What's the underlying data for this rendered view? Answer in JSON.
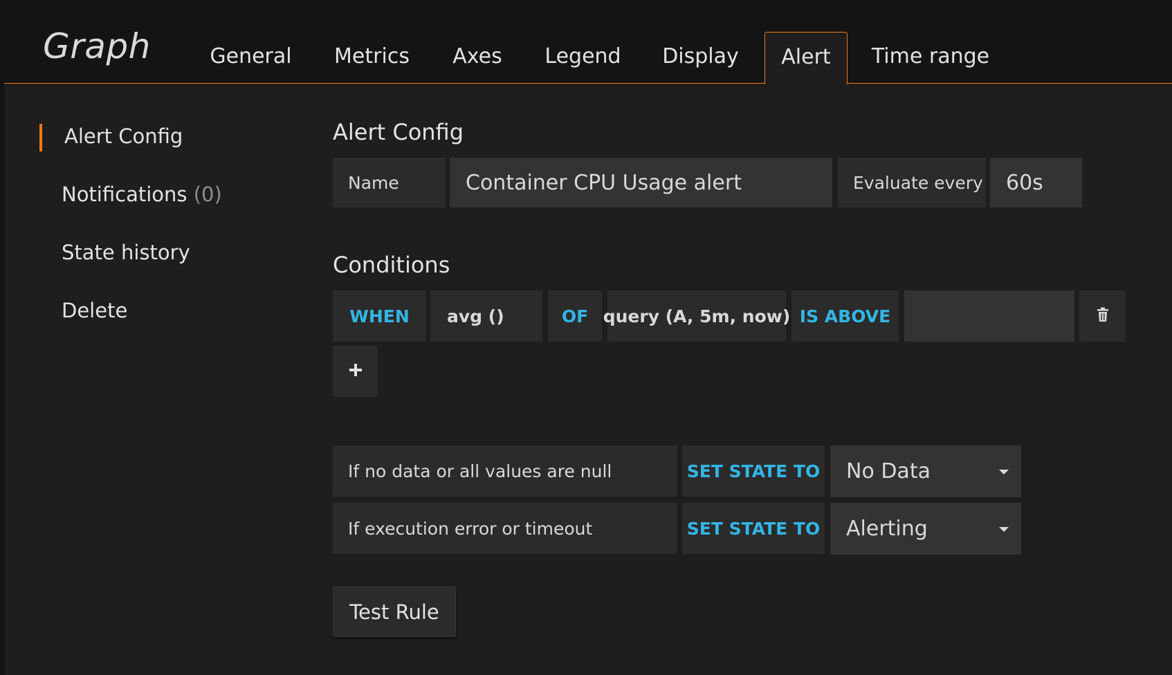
{
  "panel": {
    "title": "Graph"
  },
  "tabs": [
    {
      "label": "General"
    },
    {
      "label": "Metrics"
    },
    {
      "label": "Axes"
    },
    {
      "label": "Legend"
    },
    {
      "label": "Display"
    },
    {
      "label": "Alert",
      "active": true
    },
    {
      "label": "Time range"
    }
  ],
  "sidebar": {
    "items": [
      {
        "label": "Alert Config",
        "active": true
      },
      {
        "label": "Notifications",
        "count": "(0)"
      },
      {
        "label": "State history"
      },
      {
        "label": "Delete"
      }
    ]
  },
  "alert_config": {
    "title": "Alert Config",
    "name_label": "Name",
    "name_value": "Container CPU Usage alert",
    "evaluate_label": "Evaluate every",
    "evaluate_value": "60s"
  },
  "conditions": {
    "title": "Conditions",
    "when": "WHEN",
    "reducer": "avg ()",
    "of": "OF",
    "query": "query (A, 5m, now)",
    "evaluator": "IS ABOVE",
    "threshold": "",
    "add_icon": "plus-icon",
    "delete_icon": "trash-icon"
  },
  "state_rules": {
    "no_data_label": "If no data or all values are null",
    "no_data_keyword": "SET STATE TO",
    "no_data_value": "No Data",
    "error_label": "If execution error or timeout",
    "error_keyword": "SET STATE TO",
    "error_value": "Alerting"
  },
  "actions": {
    "test_rule": "Test Rule"
  },
  "colors": {
    "accent": "#eb7b18",
    "keyword": "#33b5e5",
    "background": "#141414",
    "panel": "#1f1d1d"
  }
}
